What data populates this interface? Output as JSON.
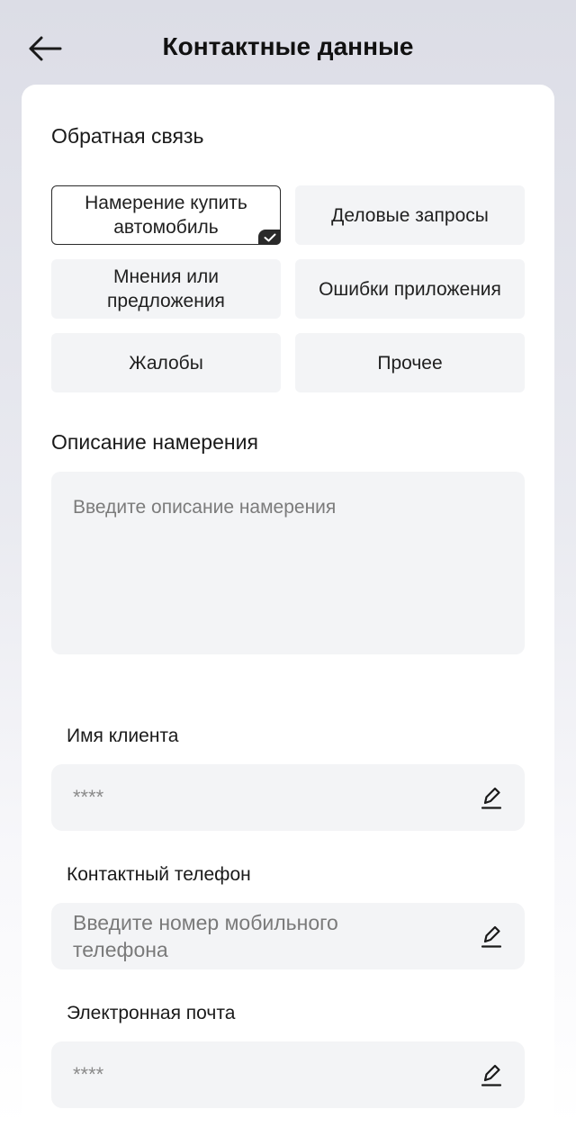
{
  "header": {
    "title": "Контактные данные"
  },
  "feedback": {
    "title": "Обратная связь",
    "options": [
      {
        "label": "Намерение купить\nавтомобиль",
        "selected": true
      },
      {
        "label": "Деловые запросы",
        "selected": false
      },
      {
        "label": "Мнения или\nпредложения",
        "selected": false
      },
      {
        "label": "Ошибки приложения",
        "selected": false
      },
      {
        "label": "Жалобы",
        "selected": false
      },
      {
        "label": "Прочее",
        "selected": false
      }
    ]
  },
  "description": {
    "title": "Описание намерения",
    "placeholder": "Введите описание намерения"
  },
  "client_name": {
    "label": "Имя клиента",
    "value": "****"
  },
  "phone": {
    "label": "Контактный телефон",
    "placeholder": "Введите номер мобильного\nтелефона"
  },
  "email": {
    "label": "Электронная почта",
    "value": "****"
  },
  "colors": {
    "accent": "#2a2a2a",
    "field_bg": "#f3f4f6",
    "card_bg": "#ffffff"
  }
}
